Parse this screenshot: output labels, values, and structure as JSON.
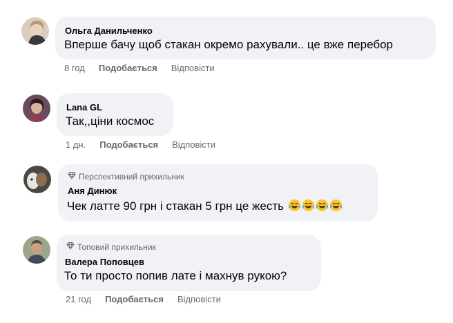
{
  "comments": [
    {
      "author": "Ольга Данильченко",
      "badge": "",
      "text": "Вперше бачу щоб стакан окремо рахували.. це вже перебор",
      "emoji_count": 0,
      "time": "8 год",
      "like_label": "Подобається",
      "reply_label": "Відповісти",
      "avatar_color": "#c9b9a6"
    },
    {
      "author": "Lana GL",
      "badge": "",
      "text": "Так,,ціни космос",
      "emoji_count": 0,
      "time": "1 дн.",
      "like_label": "Подобається",
      "reply_label": "Відповісти",
      "avatar_color": "#8a5a6a"
    },
    {
      "author": "Аня Динюк",
      "badge": "Перспективний прихильник",
      "text": "Чек латте 90 грн і стакан 5 грн це жесть",
      "emoji_count": 4,
      "emoji_icon": "face-with-tears-of-joy-icon",
      "time": "",
      "like_label": "",
      "reply_label": "",
      "avatar_color": "#5c5a55"
    },
    {
      "author": "Валера Поповцев",
      "badge": "Топовий прихильник",
      "text": "То ти просто попив лате і махнув рукою?",
      "emoji_count": 0,
      "time": "21 год",
      "like_label": "Подобається",
      "reply_label": "Відповісти",
      "avatar_color": "#7d8a6a"
    }
  ],
  "badge_icon": "diamond-icon",
  "colors": {
    "bubble": "#f0f2f5",
    "secondary_text": "#65676b",
    "primary_text": "#050505"
  }
}
